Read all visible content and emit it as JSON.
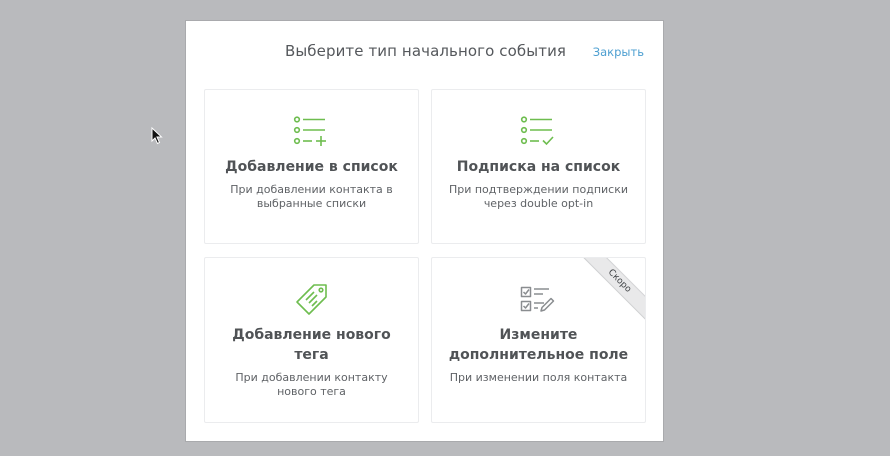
{
  "modal": {
    "title": "Выберите тип начального события",
    "close_label": "Закрыть"
  },
  "cards": [
    {
      "title": "Добавление в список",
      "description": "При добавлении контакта в выбранные списки",
      "icon": "list-add-icon"
    },
    {
      "title": "Подписка на список",
      "description": "При подтверждении подписки через double opt-in",
      "icon": "list-check-icon"
    },
    {
      "title": "Добавление нового тега",
      "description": "При добавлении контакту нового тега",
      "icon": "tag-icon"
    },
    {
      "title": "Измените дополнительное поле",
      "description": "При изменении поля контакта",
      "icon": "checklist-edit-icon",
      "badge": "Скоро"
    }
  ],
  "colors": {
    "backdrop": "#b9babd",
    "accent_green": "#6ebd4f",
    "link_blue": "#4d9fd1",
    "disabled_icon": "#8a8d90"
  }
}
